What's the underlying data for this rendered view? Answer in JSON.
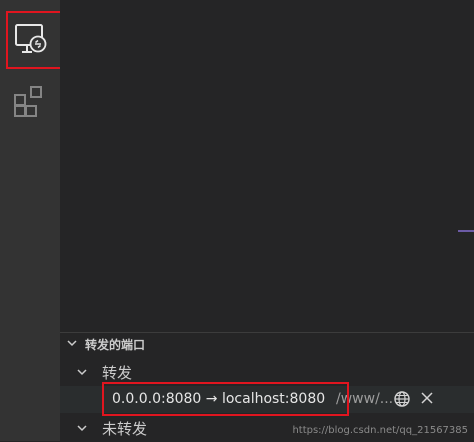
{
  "activity_bar": {
    "items": [
      {
        "icon": "remote-explorer-icon",
        "active": true
      },
      {
        "icon": "extensions-icon",
        "active": false
      }
    ]
  },
  "ports_panel": {
    "section_title": "转发的端口",
    "forwarded_group": "转发",
    "unforwarded_group": "未转发",
    "ports": [
      {
        "mapping": "0.0.0.0:8080 → localhost:8080",
        "description": "/www/..."
      }
    ]
  },
  "watermark": "https://blog.csdn.net/qq_21567385",
  "colors": {
    "highlight": "#e0151f",
    "accent_line": "#6c5ba6"
  }
}
